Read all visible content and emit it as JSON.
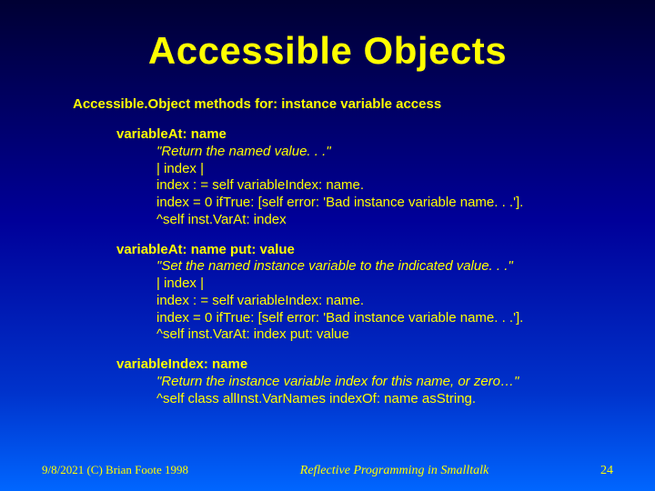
{
  "title": "Accessible Objects",
  "subtitle": "Accessible.Object methods for:  instance variable access",
  "methods": [
    {
      "sig": "variableAt: name",
      "comment": "\"Return the named value. . .\"",
      "lines": [
        "| index |",
        "index : = self variableIndex: name.",
        "index = 0 ifTrue: [self error: 'Bad instance variable name. . .'].",
        "^self inst.VarAt: index"
      ]
    },
    {
      "sig": "variableAt: name put: value",
      "comment": "\"Set the named instance variable to the indicated value. . .\"",
      "lines": [
        "| index |",
        "index : = self variableIndex: name.",
        "index = 0 ifTrue: [self error: 'Bad instance variable name. . .'].",
        "^self inst.VarAt: index put: value"
      ]
    },
    {
      "sig": "variableIndex: name",
      "comment": "\"Return the instance variable index for this name, or zero…\"",
      "lines": [
        "^self class allInst.VarNames indexOf: name asString."
      ]
    }
  ],
  "footer": {
    "left": "9/8/2021 (C) Brian Foote 1998",
    "center": "Reflective Programming in Smalltalk",
    "right": "24"
  }
}
